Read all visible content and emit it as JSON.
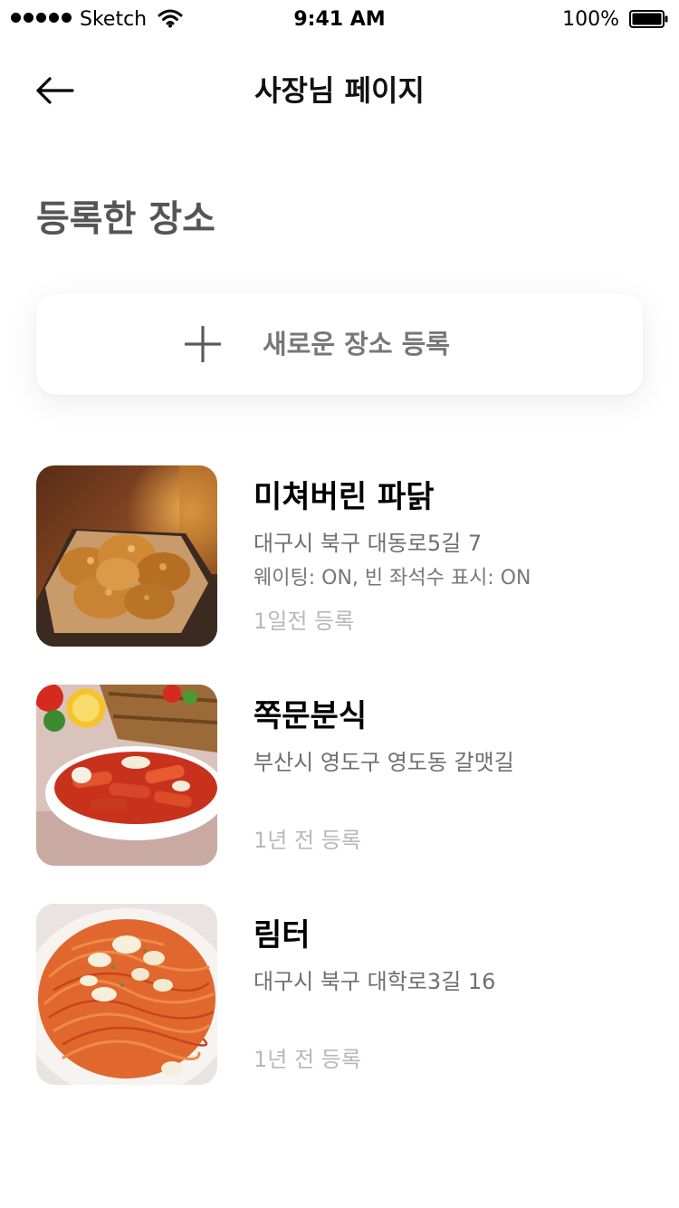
{
  "status_bar": {
    "carrier": "Sketch",
    "time": "9:41 AM",
    "battery": "100%",
    "icons": [
      "signal-dots-icon",
      "wifi-icon",
      "battery-icon"
    ]
  },
  "header": {
    "back_icon": "arrow-left-icon",
    "title": "사장님 페이지"
  },
  "section": {
    "title": "등록한 장소"
  },
  "add_place": {
    "icon": "plus-icon",
    "label": "새로운 장소 등록"
  },
  "places": [
    {
      "name": "미쳐버린 파닭",
      "address": "대구시 북구 대동로5길 7",
      "settings": "웨이팅: ON, 빈 좌석수 표시: ON",
      "registered": "1일전 등록",
      "image": "fried-chicken-photo"
    },
    {
      "name": "쪽문분식",
      "address": "부산시 영도구 영도동 갈맷길",
      "registered": "1년 전 등록",
      "image": "tteokbokki-photo"
    },
    {
      "name": "림터",
      "address": "대구시 북구 대학로3길 16",
      "registered": "1년 전 등록",
      "image": "spaghetti-photo"
    }
  ],
  "colors": {
    "title": "#111111",
    "section_title": "#555555",
    "address": "#6f6f6f",
    "date": "#b8b8b8",
    "card_bg": "#ffffff"
  }
}
